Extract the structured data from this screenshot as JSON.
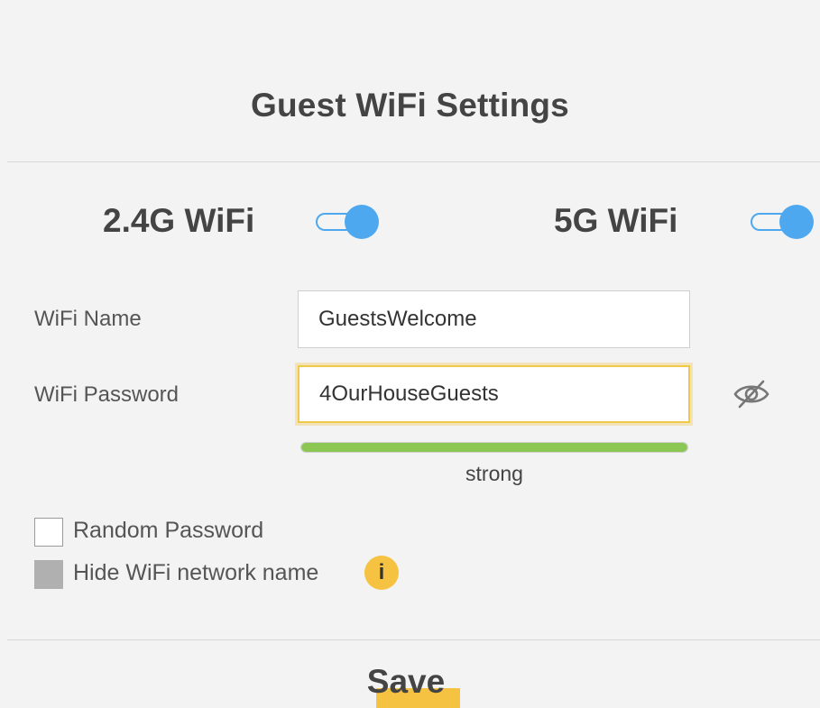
{
  "header": {
    "title": "Guest WiFi Settings"
  },
  "bands": {
    "band_24": {
      "label": "2.4G WiFi",
      "enabled": true
    },
    "band_5": {
      "label": "5G WiFi",
      "enabled": true
    }
  },
  "form": {
    "wifi_name_label": "WiFi Name",
    "wifi_name_value": "GuestsWelcome",
    "wifi_password_label": "WiFi Password",
    "wifi_password_value": "4OurHouseGuests",
    "password_visibility_icon": "eye-slash-icon",
    "strength": {
      "label": "strong",
      "level": 1.0,
      "color": "#8cc653"
    }
  },
  "options": {
    "random_password_label": "Random Password",
    "random_password_checked": false,
    "hide_network_label": "Hide WiFi network name",
    "hide_network_checked": false,
    "hide_network_disabled": true,
    "info_icon_glyph": "i"
  },
  "footer": {
    "save_label": "Save"
  },
  "colors": {
    "accent": "#4ea8f0",
    "highlight": "#f5c242",
    "strength_good": "#8cc653"
  }
}
